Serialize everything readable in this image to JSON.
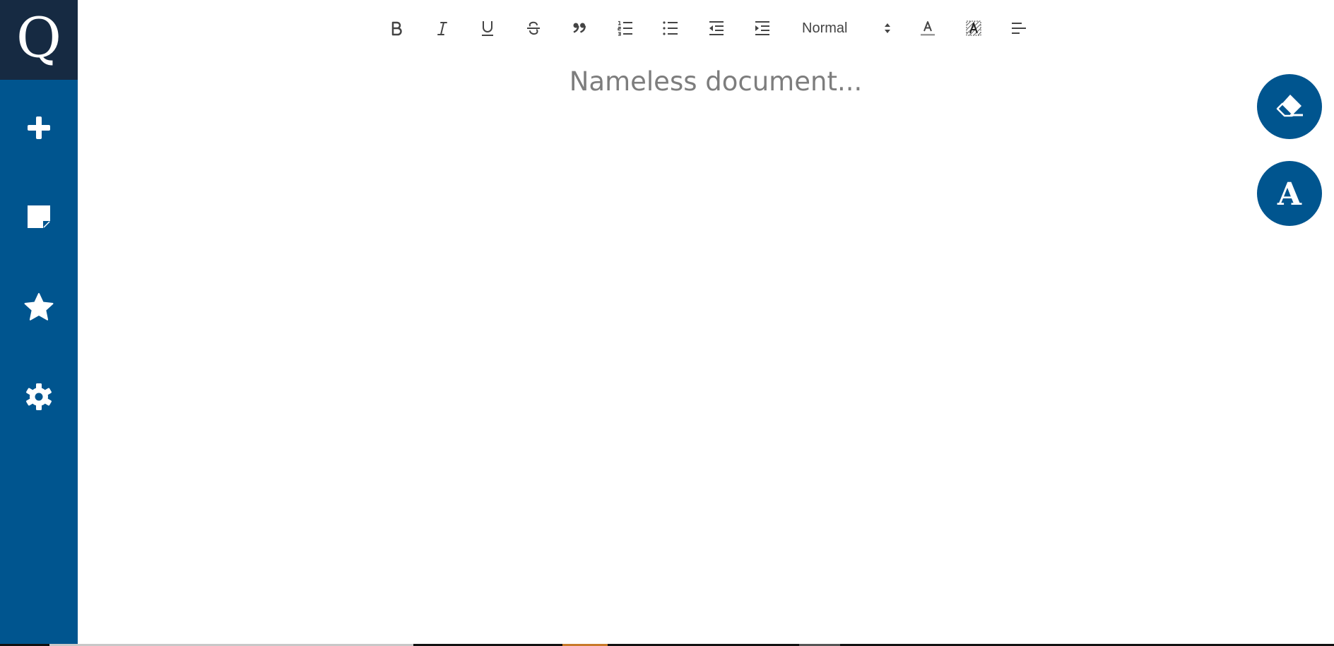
{
  "app": {
    "logo_letter": "Q"
  },
  "sidebar": {
    "items": [
      {
        "icon": "plus-icon",
        "label": "New"
      },
      {
        "icon": "note-icon",
        "label": "Notes"
      },
      {
        "icon": "star-icon",
        "label": "Favorites"
      },
      {
        "icon": "gear-icon",
        "label": "Settings"
      }
    ]
  },
  "toolbar": {
    "buttons": [
      "bold-icon",
      "italic-icon",
      "underline-icon",
      "strikethrough-icon",
      "blockquote-icon",
      "ordered-list-icon",
      "bullet-list-icon",
      "outdent-icon",
      "indent-icon",
      "text-color-icon",
      "background-color-icon",
      "align-left-icon"
    ],
    "header_select": {
      "value": "Normal"
    }
  },
  "document": {
    "title_placeholder": "Nameless document..."
  },
  "fabs": {
    "clear_icon": "eraser-icon",
    "font_letter": "A"
  },
  "colors": {
    "sidebar": "#00558f",
    "logo_bg": "#162a42",
    "toolbar_icon": "#444444",
    "title_placeholder": "#7d7d7d"
  }
}
